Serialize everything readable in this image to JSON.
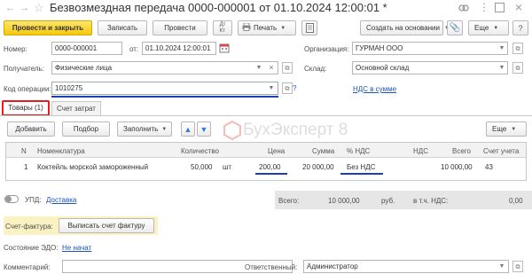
{
  "window": {
    "title": "Безвозмездная передача 0000-000001 от 01.10.2024 12:00:01 *"
  },
  "toolbar": {
    "post_close": "Провести и закрыть",
    "save": "Записать",
    "post": "Провести",
    "print": "Печать",
    "create_based": "Создать на основании",
    "more": "Еще"
  },
  "form": {
    "number_label": "Номер:",
    "number_value": "0000-000001",
    "date_label": "от:",
    "date_value": "01.10.2024 12:00:01",
    "org_label": "Организация:",
    "org_value": "ГУРМАН ООО",
    "recipient_label": "Получатель:",
    "recipient_value": "Физические лица",
    "warehouse_label": "Склад:",
    "warehouse_value": "Основной склад",
    "opcode_label": "Код операции:",
    "opcode_value": "1010275",
    "question": "?",
    "vat_link": "НДС в сумме"
  },
  "tabs": {
    "goods": "Товары (1)",
    "cost": "Счет затрат"
  },
  "table_toolbar": {
    "add": "Добавить",
    "select": "Подбор",
    "fill": "Заполнить",
    "more": "Еще"
  },
  "table": {
    "headers": {
      "n": "N",
      "item": "Номенклатура",
      "qty": "Количество",
      "price": "Цена",
      "sum": "Сумма",
      "vat_pct": "% НДС",
      "vat": "НДС",
      "total": "Всего",
      "account": "Счет учета"
    },
    "rows": [
      {
        "n": "1",
        "item": "Коктейль морской замороженный",
        "qty": "50,000",
        "unit": "шт",
        "price": "200,00",
        "sum": "20 000,00",
        "vat_pct": "Без НДС",
        "vat": "",
        "total": "10 000,00",
        "account": "43"
      }
    ]
  },
  "watermark": "БухЭксперт 8",
  "footer": {
    "upd_label": "УПД:",
    "upd_link": "Доставка",
    "total_label": "Всего:",
    "total_value": "10 000,00",
    "currency": "руб.",
    "vat_incl_label": "в т.ч. НДС:",
    "vat_incl_value": "0,00",
    "invoice_label": "Счет-фактура:",
    "invoice_button": "Выписать счет фактуру",
    "edo_label": "Состояние ЭДО:",
    "edo_link": "Не начат",
    "comment_label": "Комментарий:",
    "comment_value": "",
    "responsible_label": "Ответственный:",
    "responsible_value": "Администратор"
  },
  "colors": {
    "accent_yellow": "#f6c80d",
    "highlight_red": "#e02020",
    "underline_blue": "#1d3fb4",
    "link_blue": "#1f54b8"
  }
}
